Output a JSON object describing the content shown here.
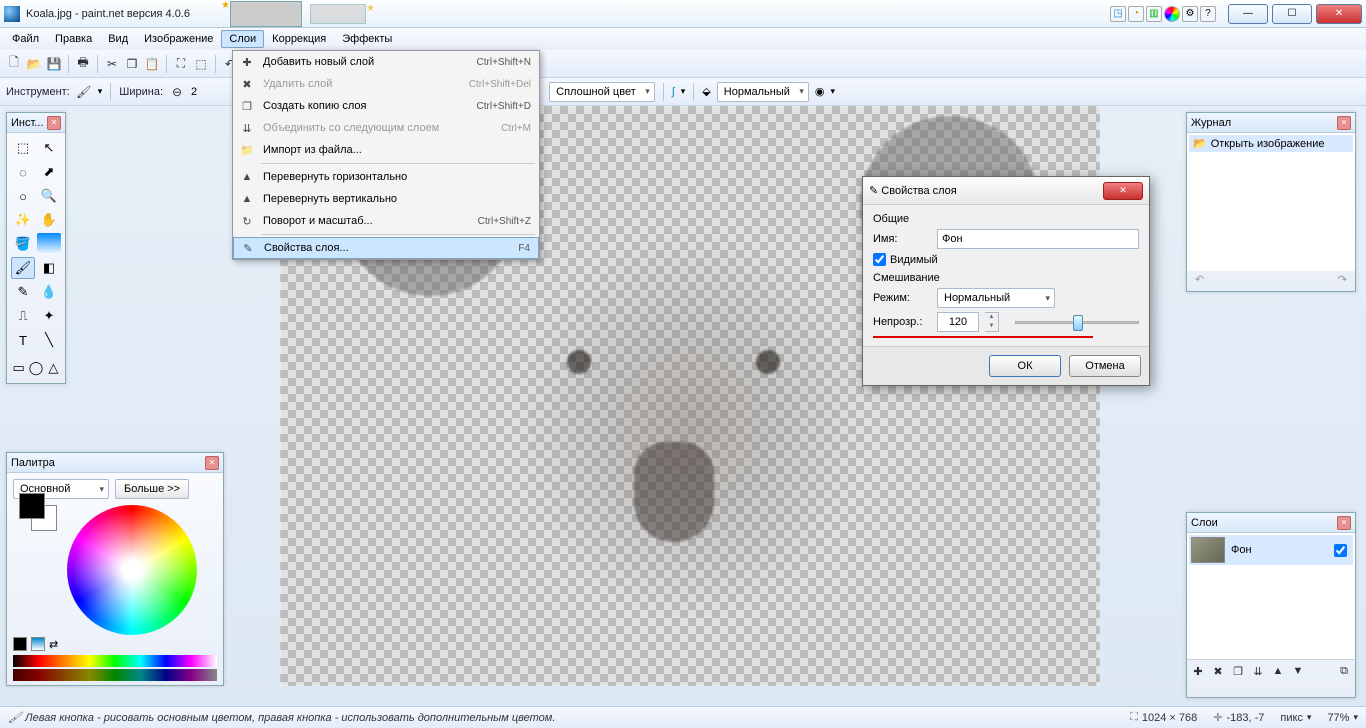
{
  "title": "Koala.jpg - paint.net версия 4.0.6",
  "menubar": [
    "Файл",
    "Правка",
    "Вид",
    "Изображение",
    "Слои",
    "Коррекция",
    "Эффекты"
  ],
  "menubar_active_index": 4,
  "toolbar2": {
    "tool_label": "Инструмент:",
    "width_label": "Ширина:",
    "width_value": "2",
    "fill_label": "Сплошной цвет",
    "blend_label": "Нормальный"
  },
  "layers_menu": [
    {
      "icon": "✚",
      "text": "Добавить новый слой",
      "short": "Ctrl+Shift+N",
      "dis": false
    },
    {
      "icon": "✖",
      "text": "Удалить слой",
      "short": "Ctrl+Shift+Del",
      "dis": true
    },
    {
      "icon": "❐",
      "text": "Создать копию слоя",
      "short": "Ctrl+Shift+D",
      "dis": false
    },
    {
      "icon": "⇊",
      "text": "Объединить со следующим слоем",
      "short": "Ctrl+M",
      "dis": true
    },
    {
      "icon": "📁",
      "text": "Импорт из файла...",
      "short": "",
      "dis": false
    },
    {
      "sep": true
    },
    {
      "icon": "▲",
      "text": "Перевернуть горизонтально",
      "short": "",
      "dis": false
    },
    {
      "icon": "▲",
      "text": "Перевернуть вертикально",
      "short": "",
      "dis": false
    },
    {
      "icon": "↻",
      "text": "Поворот и масштаб...",
      "short": "Ctrl+Shift+Z",
      "dis": false
    },
    {
      "sep": true
    },
    {
      "icon": "✎",
      "text": "Свойства слоя...",
      "short": "F4",
      "dis": false,
      "hl": true
    }
  ],
  "tools_panel": {
    "title": "Инст..."
  },
  "palette_panel": {
    "title": "Палитра",
    "primary_label": "Основной",
    "more_label": "Больше >>"
  },
  "history_panel": {
    "title": "Журнал",
    "item": "Открыть изображение"
  },
  "layers_panel": {
    "title": "Слои",
    "layer_name": "Фон"
  },
  "dialog": {
    "title": "Свойства слоя",
    "section_general": "Общие",
    "name_label": "Имя:",
    "name_value": "Фон",
    "visible_label": "Видимый",
    "section_blend": "Смешивание",
    "mode_label": "Режим:",
    "mode_value": "Нормальный",
    "opacity_label": "Непрозр.:",
    "opacity_value": "120",
    "ok": "ОК",
    "cancel": "Отмена"
  },
  "statusbar": {
    "hint": "Левая кнопка - рисовать основным цветом, правая кнопка - использовать дополнительным цветом.",
    "dims": "1024 × 768",
    "coords": "-183, -7",
    "units": "пикс",
    "zoom": "77%"
  }
}
